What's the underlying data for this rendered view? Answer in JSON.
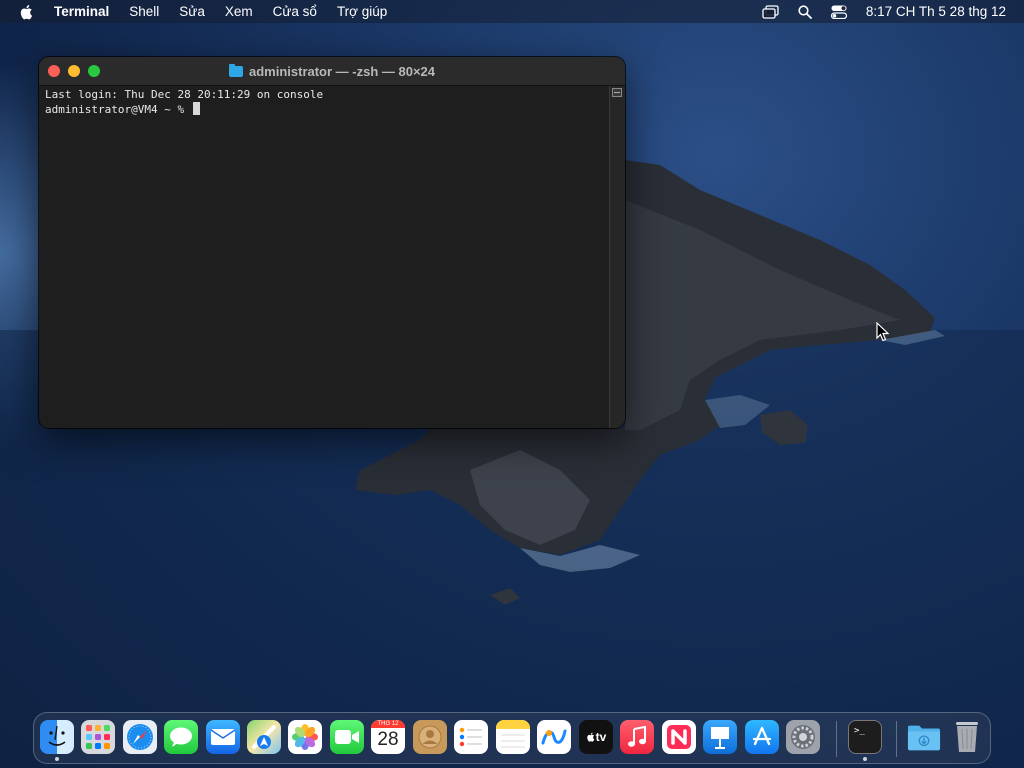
{
  "menubar": {
    "app_name": "Terminal",
    "menus": [
      "Shell",
      "Sửa",
      "Xem",
      "Cửa sổ",
      "Trợ giúp"
    ],
    "clock": "8:17 CH Th 5 28 thg 12"
  },
  "terminal": {
    "title": "administrator — -zsh — 80×24",
    "lines": [
      "Last login: Thu Dec 28 20:11:29 on console",
      "administrator@VM4 ~ % "
    ]
  },
  "dock": {
    "calendar_month": "THG 12",
    "calendar_day": "28",
    "tv_label": "tv",
    "terminal_glyph": ">_"
  },
  "colors": {
    "close": "#fe5f57",
    "minimize": "#febc2e",
    "maximize": "#28c840",
    "terminal_bg": "#1e1e1e"
  }
}
